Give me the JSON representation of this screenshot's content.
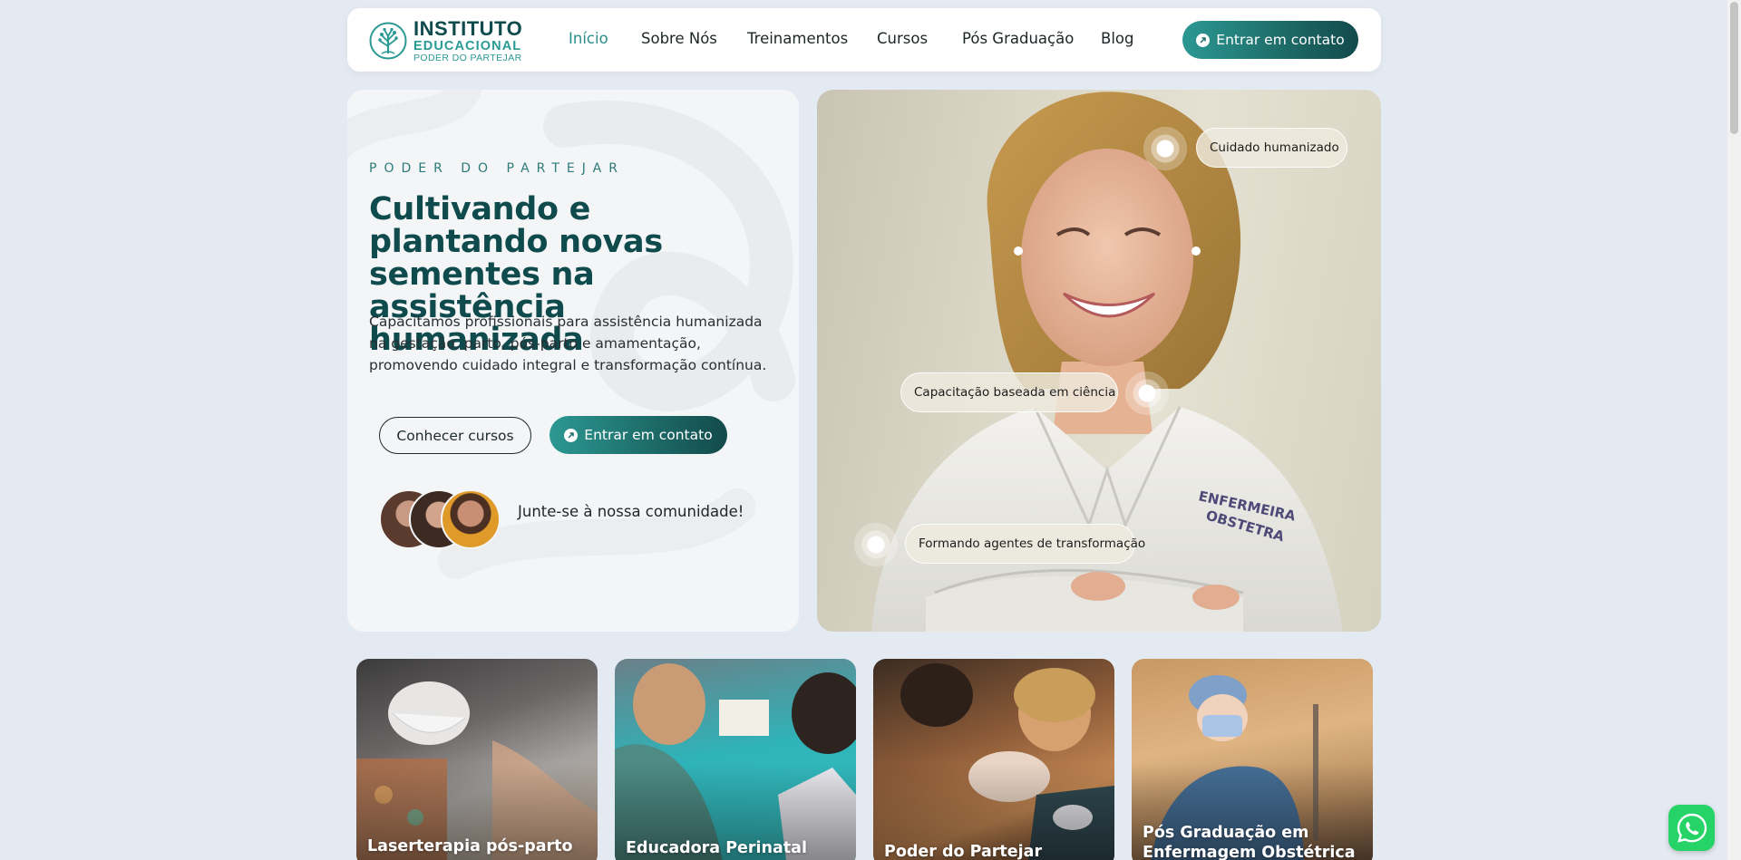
{
  "header": {
    "logo": {
      "line1": "INSTITUTO",
      "line2": "EDUCACIONAL",
      "line3": "PODER DO PARTEJAR",
      "icon": "tree-logo-icon"
    },
    "nav": [
      {
        "label": "Início",
        "active": true
      },
      {
        "label": "Sobre Nós",
        "active": false
      },
      {
        "label": "Treinamentos",
        "active": false
      },
      {
        "label": "Cursos",
        "active": false
      },
      {
        "label": "Pós Graduação",
        "active": false
      },
      {
        "label": "Blog",
        "active": false
      }
    ],
    "cta_label": "Entrar em contato"
  },
  "hero": {
    "eyebrow": "PODER DO PARTEJAR",
    "title": "Cultivando e plantando novas sementes na assistência humanizada",
    "description": "Capacitamos profissionais para assistência humanizada na gestação, parto, pós-parto e amamentação, promovendo cuidado integral e transformação contínua.",
    "secondary_button": "Conhecer cursos",
    "primary_button": "Entrar em contato",
    "community_text": "Junte-se à nossa comunidade!",
    "image_tags": [
      "Cuidado humanizado",
      "Capacitação baseada em ciência",
      "Formando agentes de transformação"
    ],
    "coat_text_line1": "ENFERMEIRA",
    "coat_text_line2": "OBSTETRA"
  },
  "courses": [
    {
      "title": "Laserterapia pós-parto"
    },
    {
      "title": "Educadora Perinatal"
    },
    {
      "title": "Poder do Partejar"
    },
    {
      "title": "Pós Graduação em Enfermagem Obstétrica"
    }
  ],
  "colors": {
    "accent": "#2a9a94",
    "brand_dark": "#0f4a4d",
    "page_bg": "#e4eaf1",
    "whatsapp": "#25d366"
  },
  "icons": {
    "cta_arrow": "arrow-up-right-icon",
    "whatsapp": "whatsapp-icon",
    "hotspot": "hotspot-dot-icon"
  }
}
